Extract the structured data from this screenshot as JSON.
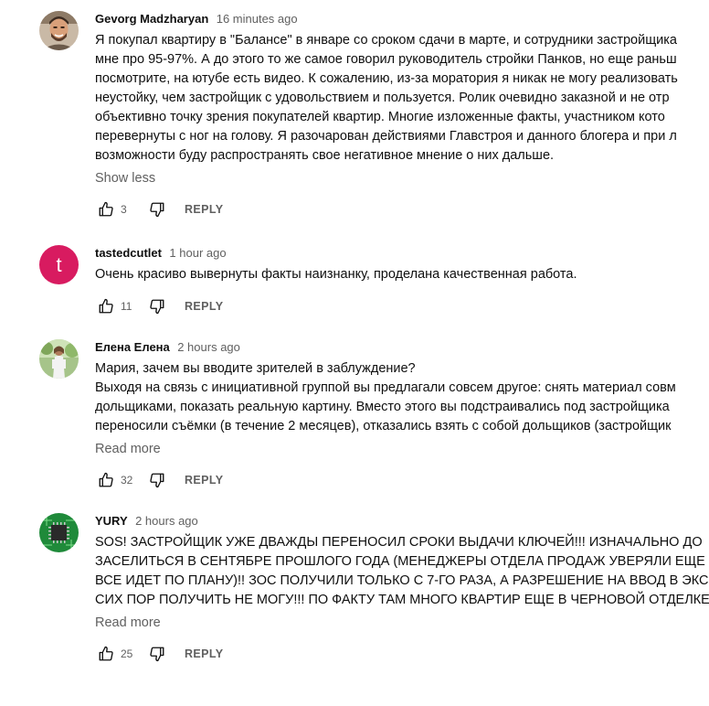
{
  "comments": [
    {
      "author": "Gevorg Madzharyan",
      "time": "16 minutes ago",
      "avatar_type": "photo-man",
      "lines": [
        "Я покупал квартиру в \"Балансе\" в январе со сроком сдачи в марте, и сотрудники застройщика",
        "мне про 95-97%. А до этого то же самое говорил руководитель стройки Панков, но еще раньш",
        "посмотрите, на ютубе есть видео. К сожалению, из-за моратория я никак не могу реализовать",
        "неустойку, чем застройщик с удовольствием и пользуется. Ролик очевидно заказной и не отр",
        "объективно точку зрения покупателей квартир. Многие изложенные факты, участником кото",
        "перевернуты с ног на голову. Я разочарован действиями Главстроя и данного блогера и при л",
        "возможности буду распространять свое негативное мнение о них дальше."
      ],
      "more_label": "Show less",
      "likes": "3",
      "reply_label": "REPLY"
    },
    {
      "author": "tastedcutlet",
      "time": "1 hour ago",
      "avatar_type": "letter",
      "avatar_letter": "t",
      "avatar_color": "#d81b60",
      "lines": [
        "Очень красиво вывернуты факты наизнанку, проделана качественная работа."
      ],
      "more_label": "",
      "likes": "11",
      "reply_label": "REPLY"
    },
    {
      "author": "Елена Елена",
      "time": "2 hours ago",
      "avatar_type": "photo-woman",
      "lines": [
        "Мария, зачем вы вводите зрителей в заблуждение?",
        "Выходя на связь с инициативной группой вы предлагали совсем другое: снять материал совм",
        "дольщиками, показать реальную картину. Вместо этого вы подстраивались под застройщика",
        "переносили съёмки (в течение 2 месяцев), отказались взять с собой дольщиков (застройщик"
      ],
      "more_label": "Read more",
      "likes": "32",
      "reply_label": "REPLY"
    },
    {
      "author": "YURY",
      "time": "2 hours ago",
      "avatar_type": "chip",
      "lines": [
        "SOS! ЗАСТРОЙЩИК УЖЕ ДВАЖДЫ ПЕРЕНОСИЛ СРОКИ ВЫДАЧИ КЛЮЧЕЙ!!! ИЗНАЧАЛЬНО ДО",
        "ЗАСЕЛИТЬСЯ В СЕНТЯБРЕ ПРОШЛОГО ГОДА (МЕНЕДЖЕРЫ ОТДЕЛА ПРОДАЖ УВЕРЯЛИ ЕЩЕ",
        "ВСЕ ИДЕТ ПО ПЛАНУ)!! ЗОС ПОЛУЧИЛИ ТОЛЬКО С 7-ГО РАЗА, А РАЗРЕШЕНИЕ НА ВВОД В ЭКС",
        "СИХ ПОР ПОЛУЧИТЬ НЕ МОГУ!!! ПО ФАКТУ ТАМ МНОГО КВАРТИР ЕЩЕ В ЧЕРНОВОЙ ОТДЕЛКЕ"
      ],
      "more_label": "Read more",
      "likes": "25",
      "reply_label": "REPLY"
    }
  ]
}
